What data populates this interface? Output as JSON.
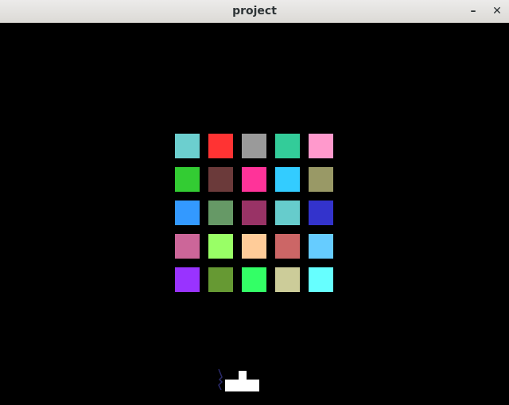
{
  "window": {
    "title": "project",
    "minimize_glyph": "–",
    "close_glyph": "✕"
  },
  "game": {
    "blocks": [
      [
        "#6ccfcf",
        "#ff3333",
        "#9a9a9a",
        "#33cc99",
        "#ff99cc"
      ],
      [
        "#33cc33",
        "#6b3a3a",
        "#ff3399",
        "#33ccff",
        "#999966"
      ],
      [
        "#3399ff",
        "#669966",
        "#993366",
        "#66cccc",
        "#3333cc"
      ],
      [
        "#cc6699",
        "#99ff66",
        "#ffcc99",
        "#cc6666",
        "#66ccff"
      ],
      [
        "#9933ff",
        "#669933",
        "#33ff66",
        "#cccc99",
        "#66ffff"
      ]
    ],
    "player_color": "#ffffff"
  }
}
